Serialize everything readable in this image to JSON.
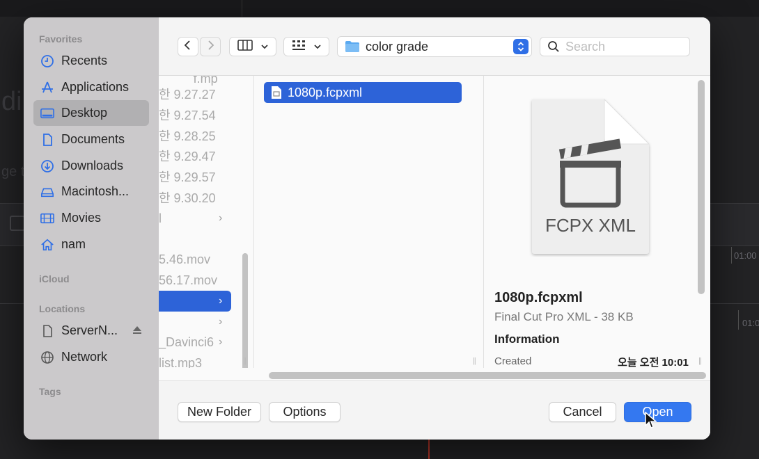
{
  "sidebar": {
    "favorites_header": "Favorites",
    "favorites": [
      {
        "label": "Recents",
        "icon": "clock-icon"
      },
      {
        "label": "Applications",
        "icon": "applications-icon"
      },
      {
        "label": "Desktop",
        "icon": "desktop-icon",
        "selected": true
      },
      {
        "label": "Documents",
        "icon": "document-icon"
      },
      {
        "label": "Downloads",
        "icon": "download-icon"
      },
      {
        "label": "Macintosh...",
        "icon": "disk-icon"
      },
      {
        "label": "Movies",
        "icon": "film-icon"
      },
      {
        "label": "nam",
        "icon": "home-icon"
      }
    ],
    "icloud_header": "iCloud",
    "locations_header": "Locations",
    "locations": [
      {
        "label": "ServerN...",
        "icon": "server-icon"
      },
      {
        "label": "Network",
        "icon": "globe-icon"
      }
    ],
    "tags_header": "Tags"
  },
  "toolbar": {
    "path_label": "color grade",
    "search_placeholder": "Search"
  },
  "column1": {
    "rows": [
      "ㅤㅤㅤf.mp",
      "한 9.27.27",
      "한 9.27.54",
      "한 9.28.25",
      "한 9.29.47",
      "한 9.29.57",
      "한 9.30.20",
      "l",
      "",
      "5.46.mov",
      "56.17.mov",
      "",
      "",
      "_Davinci6",
      "list.mp3"
    ]
  },
  "column2": {
    "selected_file": "1080p.fcpxml"
  },
  "preview": {
    "icon_caption": "FCPX XML",
    "name": "1080p.fcpxml",
    "kind": "Final Cut Pro XML - 38 KB",
    "info_header": "Information",
    "created_label": "Created",
    "created_value": "오늘 오전 10:01"
  },
  "footer": {
    "new_folder": "New Folder",
    "options": "Options",
    "cancel": "Cancel",
    "open": "Open"
  },
  "colors": {
    "accent": "#2d63d8",
    "primary_button": "#3478f0",
    "sidebar_bg": "#cbc9cb",
    "sidebar_icon": "#2f6fe6"
  }
}
